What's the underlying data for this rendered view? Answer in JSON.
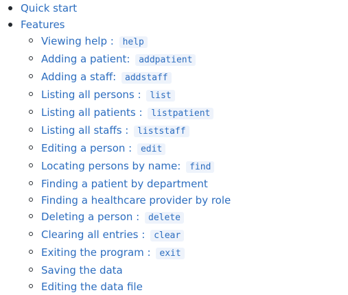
{
  "toc": {
    "items": [
      {
        "label": "Quick start"
      },
      {
        "label": "Features"
      }
    ],
    "features": [
      {
        "text": "Viewing help : ",
        "code": "help"
      },
      {
        "text": "Adding a patient: ",
        "code": "addpatient"
      },
      {
        "text": "Adding a staff: ",
        "code": "addstaff"
      },
      {
        "text": "Listing all persons : ",
        "code": "list"
      },
      {
        "text": "Listing all patients : ",
        "code": "listpatient"
      },
      {
        "text": "Listing all staffs : ",
        "code": "liststaff"
      },
      {
        "text": "Editing a person : ",
        "code": "edit"
      },
      {
        "text": "Locating persons by name: ",
        "code": "find"
      },
      {
        "text": "Finding a patient by department"
      },
      {
        "text": "Finding a healthcare provider by role"
      },
      {
        "text": "Deleting a person : ",
        "code": "delete"
      },
      {
        "text": "Clearing all entries : ",
        "code": "clear"
      },
      {
        "text": "Exiting the program : ",
        "code": "exit"
      },
      {
        "text": "Saving the data"
      },
      {
        "text": "Editing the data file"
      }
    ]
  }
}
